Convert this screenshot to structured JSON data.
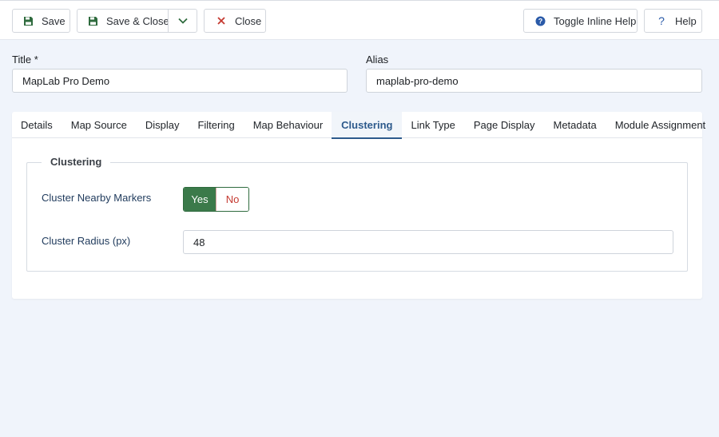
{
  "toolbar": {
    "save_label": "Save",
    "save_close_label": "Save & Close",
    "close_label": "Close",
    "toggle_help_label": "Toggle Inline Help",
    "help_label": "Help"
  },
  "form": {
    "title_label": "Title *",
    "title_value": "MapLab Pro Demo",
    "alias_label": "Alias",
    "alias_value": "maplab-pro-demo"
  },
  "tabs": [
    {
      "label": "Details"
    },
    {
      "label": "Map Source"
    },
    {
      "label": "Display"
    },
    {
      "label": "Filtering"
    },
    {
      "label": "Map Behaviour"
    },
    {
      "label": "Clustering",
      "active": true
    },
    {
      "label": "Link Type"
    },
    {
      "label": "Page Display"
    },
    {
      "label": "Metadata"
    },
    {
      "label": "Module Assignment"
    }
  ],
  "clustering": {
    "legend": "Clustering",
    "nearby_label": "Cluster Nearby Markers",
    "yes_label": "Yes",
    "no_label": "No",
    "selected": "Yes",
    "radius_label": "Cluster Radius (px)",
    "radius_value": "48"
  },
  "colors": {
    "save_icon": "#2f6b3e",
    "close_icon": "#c53a31",
    "help_icon": "#2a5aa8",
    "active_tab": "#2d5a8c",
    "switch_on": "#3b7a4a"
  }
}
